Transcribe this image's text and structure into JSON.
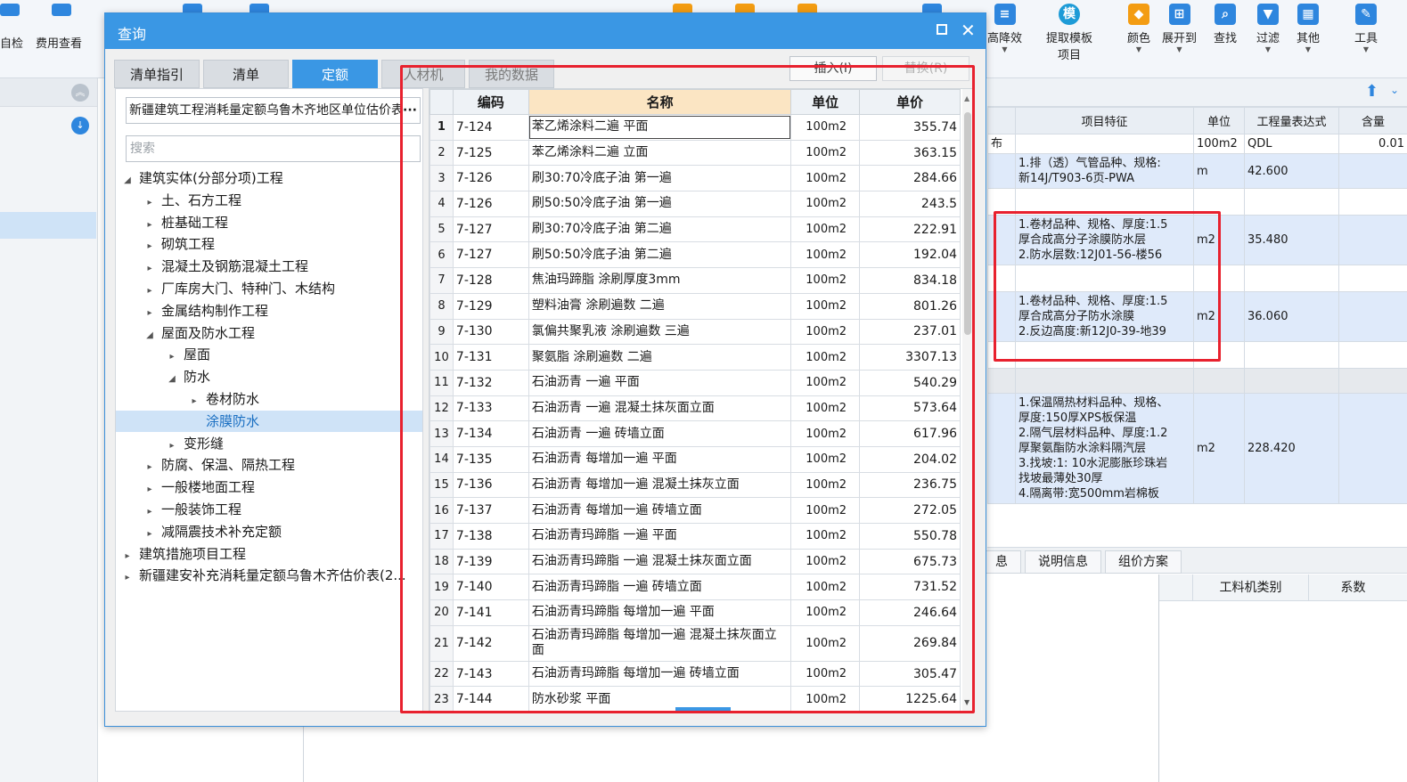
{
  "toolbar": {
    "left_items": [
      "自检",
      "费用查看"
    ],
    "right_items": [
      {
        "label": "高降效",
        "icon": "list-icon",
        "caret": true
      },
      {
        "label": "提取模板项目",
        "icon": "template-icon",
        "caret": false
      },
      {
        "label": "颜色",
        "icon": "color-icon",
        "caret": true
      },
      {
        "label": "展开到",
        "icon": "expand-icon",
        "caret": true
      },
      {
        "label": "查找",
        "icon": "find-icon",
        "caret": false
      },
      {
        "label": "过滤",
        "icon": "filter-icon",
        "caret": true
      },
      {
        "label": "其他",
        "icon": "grid-icon",
        "caret": true
      },
      {
        "label": "工具",
        "icon": "tool-icon",
        "caret": true
      }
    ],
    "template_line1": "提取模板",
    "template_line2": "项目",
    "template_icon_glyph": "模"
  },
  "dialog": {
    "title": "查询",
    "tabs": [
      "清单指引",
      "清单",
      "定额",
      "人材机",
      "我的数据"
    ],
    "active_tab": "定额",
    "insert_label": "插入(I)",
    "replace_label": "替换(R)",
    "library": "新疆建筑工程消耗量定额乌鲁木齐地区单位估价表",
    "library_more": "···",
    "search_placeholder": "搜索",
    "tree": [
      {
        "label": "建筑实体(分部分项)工程",
        "level": 0,
        "arrow": "◢"
      },
      {
        "label": "土、石方工程",
        "level": 1,
        "arrow": "▸"
      },
      {
        "label": "桩基础工程",
        "level": 1,
        "arrow": "▸"
      },
      {
        "label": "砌筑工程",
        "level": 1,
        "arrow": "▸"
      },
      {
        "label": "混凝土及钢筋混凝土工程",
        "level": 1,
        "arrow": "▸"
      },
      {
        "label": "厂库房大门、特种门、木结构",
        "level": 1,
        "arrow": "▸"
      },
      {
        "label": "金属结构制作工程",
        "level": 1,
        "arrow": "▸"
      },
      {
        "label": "屋面及防水工程",
        "level": 1,
        "arrow": "◢"
      },
      {
        "label": "屋面",
        "level": 2,
        "arrow": "▸"
      },
      {
        "label": "防水",
        "level": 2,
        "arrow": "◢"
      },
      {
        "label": "卷材防水",
        "level": 3,
        "arrow": "▸"
      },
      {
        "label": "涂膜防水",
        "level": 3,
        "arrow": "",
        "selected": true
      },
      {
        "label": "变形缝",
        "level": 2,
        "arrow": "▸"
      },
      {
        "label": "防腐、保温、隔热工程",
        "level": 1,
        "arrow": "▸"
      },
      {
        "label": "一般楼地面工程",
        "level": 1,
        "arrow": "▸"
      },
      {
        "label": "一般装饰工程",
        "level": 1,
        "arrow": "▸"
      },
      {
        "label": "减隔震技术补充定额",
        "level": 1,
        "arrow": "▸"
      },
      {
        "label": "建筑措施项目工程",
        "level": 0,
        "arrow": "▸"
      },
      {
        "label": "新疆建安补充消耗量定额乌鲁木齐估价表(2...",
        "level": 0,
        "arrow": "▸"
      }
    ],
    "grid": {
      "headers": [
        "",
        "编码",
        "名称",
        "单位",
        "单价"
      ],
      "rows": [
        [
          "1",
          "7-124",
          "苯乙烯涂料二遍 平面",
          "100m2",
          "355.74"
        ],
        [
          "2",
          "7-125",
          "苯乙烯涂料二遍 立面",
          "100m2",
          "363.15"
        ],
        [
          "3",
          "7-126",
          "刷30:70冷底子油 第一遍",
          "100m2",
          "284.66"
        ],
        [
          "4",
          "7-126",
          "刷50:50冷底子油 第一遍",
          "100m2",
          "243.5"
        ],
        [
          "5",
          "7-127",
          "刷30:70冷底子油 第二遍",
          "100m2",
          "222.91"
        ],
        [
          "6",
          "7-127",
          "刷50:50冷底子油 第二遍",
          "100m2",
          "192.04"
        ],
        [
          "7",
          "7-128",
          "焦油玛蹄脂 涂刷厚度3mm",
          "100m2",
          "834.18"
        ],
        [
          "8",
          "7-129",
          "塑料油膏 涂刷遍数 二遍",
          "100m2",
          "801.26"
        ],
        [
          "9",
          "7-130",
          "氯偏共聚乳液 涂刷遍数 三遍",
          "100m2",
          "237.01"
        ],
        [
          "10",
          "7-131",
          "聚氨脂 涂刷遍数 二遍",
          "100m2",
          "3307.13"
        ],
        [
          "11",
          "7-132",
          "石油沥青 一遍 平面",
          "100m2",
          "540.29"
        ],
        [
          "12",
          "7-133",
          "石油沥青 一遍 混凝土抹灰面立面",
          "100m2",
          "573.64"
        ],
        [
          "13",
          "7-134",
          "石油沥青 一遍 砖墙立面",
          "100m2",
          "617.96"
        ],
        [
          "14",
          "7-135",
          "石油沥青 每增加一遍 平面",
          "100m2",
          "204.02"
        ],
        [
          "15",
          "7-136",
          "石油沥青 每增加一遍 混凝土抹灰立面",
          "100m2",
          "236.75"
        ],
        [
          "16",
          "7-137",
          "石油沥青 每增加一遍 砖墙立面",
          "100m2",
          "272.05"
        ],
        [
          "17",
          "7-138",
          "石油沥青玛蹄脂 一遍 平面",
          "100m2",
          "550.78"
        ],
        [
          "18",
          "7-139",
          "石油沥青玛蹄脂 一遍 混凝土抹灰面立面",
          "100m2",
          "675.73"
        ],
        [
          "19",
          "7-140",
          "石油沥青玛蹄脂 一遍 砖墙立面",
          "100m2",
          "731.52"
        ],
        [
          "20",
          "7-141",
          "石油沥青玛蹄脂 每增加一遍 平面",
          "100m2",
          "246.64"
        ],
        [
          "21",
          "7-142",
          "石油沥青玛蹄脂 每增加一遍 混凝土抹灰面立面",
          "100m2",
          "269.84"
        ],
        [
          "22",
          "7-143",
          "石油沥青玛蹄脂 每增加一遍 砖墙立面",
          "100m2",
          "305.47"
        ],
        [
          "23",
          "7-144",
          "防水砂浆 平面",
          "100m2",
          "1225.64"
        ]
      ]
    }
  },
  "right_panel": {
    "headers": [
      "",
      "项目特征",
      "单位",
      "工程量表达式",
      "含量"
    ],
    "rows": [
      {
        "type": "plain",
        "cells": [
          "布",
          "",
          "100m2",
          "QDL",
          "0.01"
        ]
      },
      {
        "type": "hl",
        "cells": [
          "",
          "1.排（透）气管品种、规格:\n新14J/T903-6页-PWA",
          "m",
          "42.600",
          ""
        ]
      },
      {
        "type": "gap",
        "cells": [
          "",
          "",
          "",
          "",
          ""
        ]
      },
      {
        "type": "hl",
        "cells": [
          "",
          "1.卷材品种、规格、厚度:1.5\n厚合成高分子涂膜防水层\n2.防水层数:12J01-56-楼56",
          "m2",
          "35.480",
          ""
        ]
      },
      {
        "type": "gap",
        "cells": [
          "",
          "",
          "",
          "",
          ""
        ]
      },
      {
        "type": "hl",
        "cells": [
          "",
          "1.卷材品种、规格、厚度:1.5\n厚合成高分子防水涂膜\n2.反边高度:新12J0-39-地39",
          "m2",
          "36.060",
          ""
        ]
      },
      {
        "type": "gap",
        "cells": [
          "",
          "",
          "",
          "",
          ""
        ]
      },
      {
        "type": "grey",
        "cells": [
          "",
          "",
          "",
          "",
          ""
        ]
      },
      {
        "type": "hl",
        "cells": [
          "",
          "1.保温隔热材料品种、规格、\n厚度:150厚XPS板保温\n2.隔气层材料品种、厚度:1.2\n厚聚氨酯防水涂料隔汽层\n3.找坡:1: 10水泥膨胀珍珠岩\n找坡最薄处30厚\n4.隔离带:宽500mm岩棉板",
          "m2",
          "228.420",
          ""
        ]
      }
    ],
    "tabs": [
      "息",
      "说明信息",
      "组价方案"
    ],
    "sub_headers": [
      "工料机类别",
      "系数"
    ]
  },
  "colors": {
    "accent": "#3a97e4",
    "highlight_box": "#e8212e",
    "selected_row": "#cfe3f7",
    "header_highlight": "#fbe5c3"
  }
}
